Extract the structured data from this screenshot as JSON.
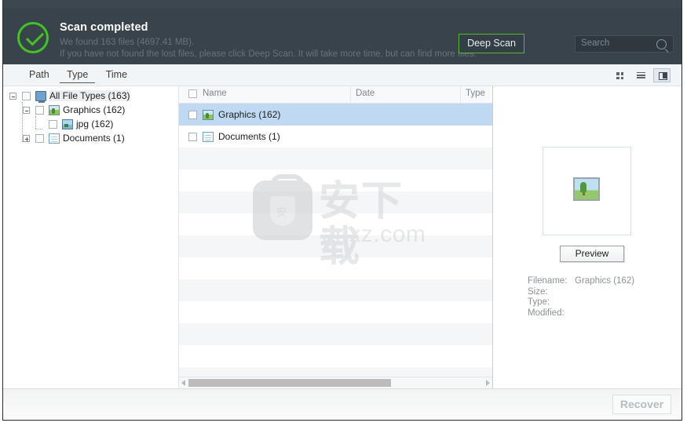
{
  "header": {
    "status_title": "Scan completed",
    "status_line1": "We found 163 files (4697.41 MB).",
    "status_line2": "If you have not found the lost files, please click Deep Scan. It will take more time, but can find more files.",
    "deep_scan_label": "Deep Scan",
    "search_placeholder": "Search",
    "accent_green": "#3fc51f",
    "bg_dark": "#39434b",
    "check_icon": "check-circle-icon",
    "search_icon": "magnifier-icon"
  },
  "toolbar": {
    "tabs": [
      {
        "label": "Path",
        "active": false
      },
      {
        "label": "Type",
        "active": true
      },
      {
        "label": "Time",
        "active": false
      }
    ],
    "view_modes": [
      {
        "name": "grid-view-icon",
        "active": false
      },
      {
        "name": "list-view-icon",
        "active": false
      },
      {
        "name": "detail-view-icon",
        "active": true
      }
    ]
  },
  "tree": {
    "nodes": [
      {
        "label": "All File Types (163)",
        "icon": "monitor-icon",
        "depth": 0,
        "expander": "minus",
        "checked": false,
        "selected": true
      },
      {
        "label": "Graphics (162)",
        "icon": "image-green-icon",
        "depth": 1,
        "expander": "minus",
        "checked": false,
        "selected": false
      },
      {
        "label": "jpg (162)",
        "icon": "image-blue-icon",
        "depth": 2,
        "expander": "none",
        "checked": false,
        "selected": false
      },
      {
        "label": "Documents (1)",
        "icon": "document-icon",
        "depth": 1,
        "expander": "plus",
        "checked": false,
        "selected": false
      }
    ]
  },
  "filelist": {
    "columns": [
      "Name",
      "Date",
      "Type"
    ],
    "rows": [
      {
        "name": "Graphics (162)",
        "icon": "image-green-icon",
        "selected": true,
        "checked": false
      },
      {
        "name": "Documents (1)",
        "icon": "document-icon",
        "selected": false,
        "checked": false
      }
    ],
    "empty_rows": 11,
    "watermark": {
      "cn": "安下载",
      "text": "anxz.com",
      "badge": "安"
    }
  },
  "preview": {
    "thumbnail_icon": "image-thumbnail-icon",
    "button_label": "Preview",
    "fields": [
      {
        "key": "Filename:",
        "value": "Graphics (162)"
      },
      {
        "key": "Size:",
        "value": ""
      },
      {
        "key": "Type:",
        "value": ""
      },
      {
        "key": "Modified:",
        "value": ""
      }
    ]
  },
  "footer": {
    "recover_label": "Recover",
    "recover_enabled": false
  }
}
